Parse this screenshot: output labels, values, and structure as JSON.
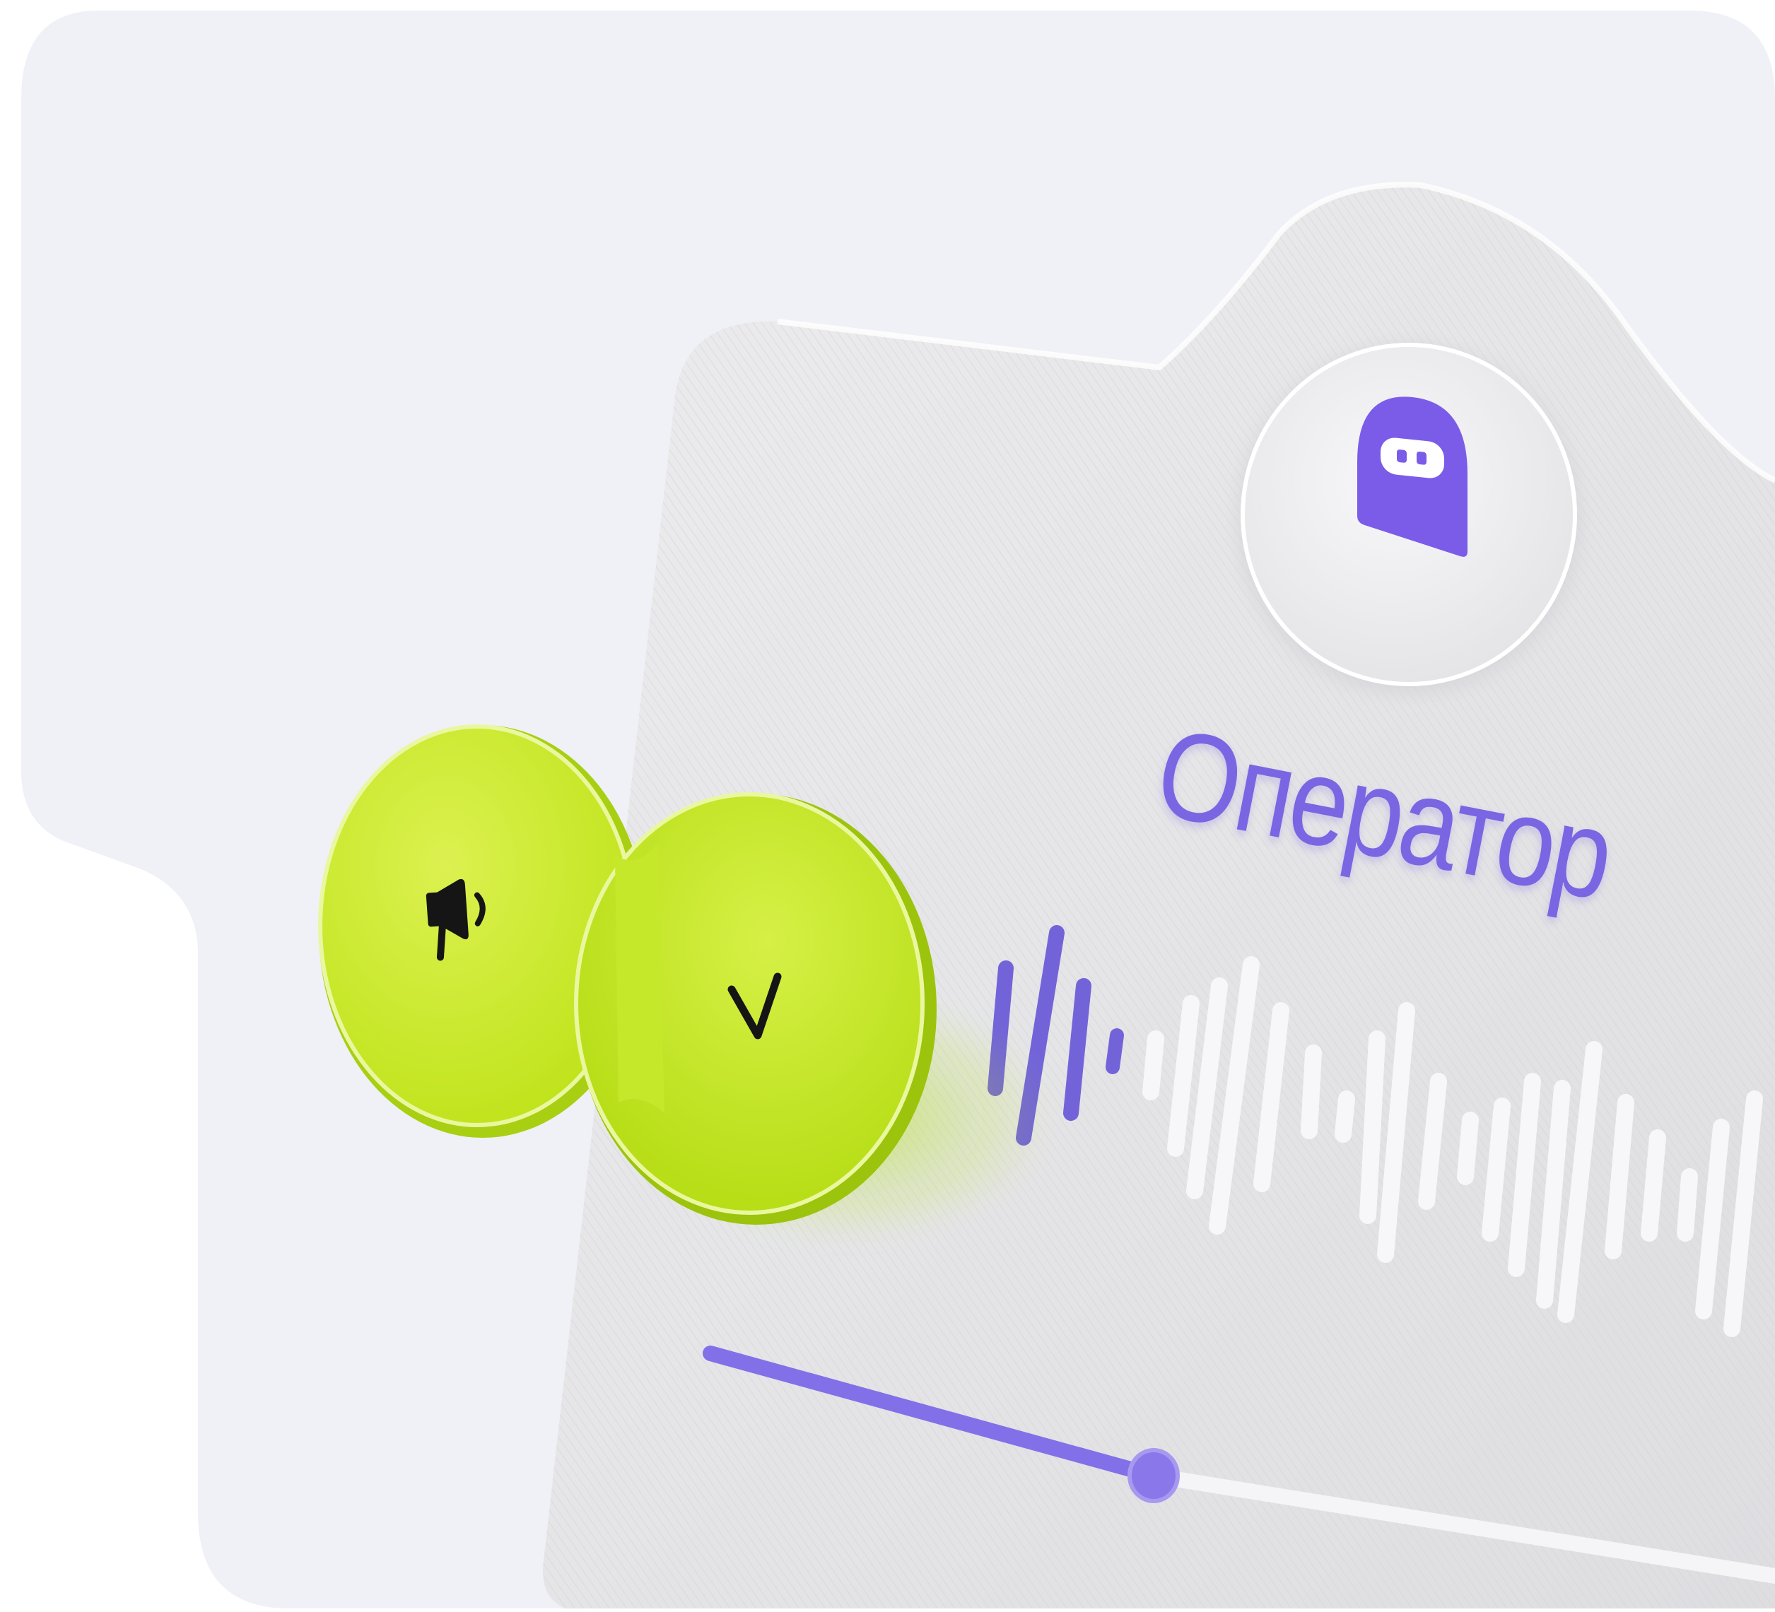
{
  "card": {
    "title": "Оператор"
  },
  "icons": {
    "avatar": "robot-face-icon",
    "speaker": "megaphone-icon",
    "accept": "check-icon"
  },
  "player": {
    "progress": 0.45
  },
  "colors": {
    "background": "#eff1f6",
    "card": "#e6e6e8",
    "accent": "#7a66e2",
    "green": "#c5ea1e",
    "wave_inactive": "#f7f7f9"
  }
}
